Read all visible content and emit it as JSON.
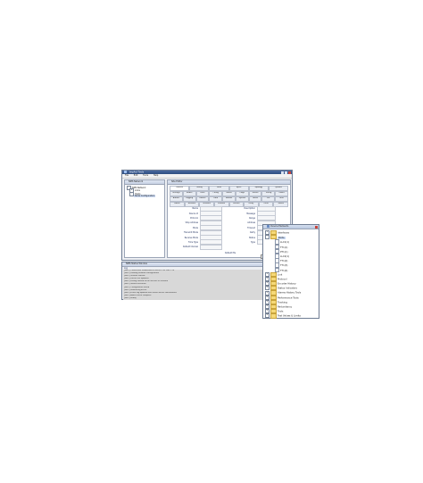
{
  "main_window": {
    "title": "ImpAct Tools",
    "menu": [
      "File",
      "Edit",
      "Tools",
      "Help"
    ],
    "tree_title": "NMS Network",
    "tree": [
      "NMS Network",
      "Links",
      "Hosts",
      "Node Configuration"
    ],
    "detail_title": "Site Editor",
    "tab_rows": [
      [
        "General",
        "Timing",
        "Links",
        "Inject",
        "Topology",
        "Options"
      ],
      [
        "Settings",
        "Modes",
        "Ports",
        "Config",
        "Status",
        "Flags",
        "Events",
        "Timing",
        "Power"
      ],
      [
        "Alarms",
        "Logging",
        "Routes",
        "Data",
        "Params",
        "System",
        "Notes",
        "Ext",
        "Misc"
      ],
      [
        "Labels",
        "Network",
        "Sessions",
        "Protocol",
        "Version",
        "Delay",
        "Other",
        "Status"
      ]
    ],
    "form_left": [
      {
        "label": "Name",
        "value": ""
      },
      {
        "label": "Device Id",
        "value": ""
      },
      {
        "label": "Protocol",
        "value": ""
      },
      {
        "label": "Stop Address",
        "value": ""
      },
      {
        "label": "Mode",
        "value": ""
      },
      {
        "label": "Transmit Mode",
        "value": ""
      },
      {
        "label": "Receive Mode",
        "value": ""
      },
      {
        "label": "Time Type",
        "value": ""
      },
      {
        "label": "Default Interval",
        "value": ""
      }
    ],
    "form_right": [
      {
        "label": "Description",
        "value": ""
      },
      {
        "label": "Message",
        "value": ""
      },
      {
        "label": "Range",
        "value": ""
      },
      {
        "label": "Address",
        "value": ""
      },
      {
        "label": "Timeout",
        "value": ""
      },
      {
        "label": "Retry",
        "value": ""
      },
      {
        "label": "Status",
        "value": ""
      },
      {
        "label": "Type",
        "value": ""
      }
    ],
    "form_footer": "Default Pts",
    "apply_label": "Apply"
  },
  "log_window": {
    "title": "NMS Status Window",
    "subtitle": "Log",
    "lines": [
      "[INFO] Connection established to server 192.168.1.10",
      "[INFO] Loading network configuration",
      "[INFO] Session started",
      "[INFO] Device list updated",
      "[INFO] Polling started for all devices in network",
      "[INFO] Status refreshed",
      "[INFO] Configuration saved",
      "[INFO] Monitoring active",
      "[INFO] Event log updated with latest device notifications",
      "[INFO] Alarm check complete",
      "[INFO] Ready"
    ]
  },
  "device_window": {
    "title": "Device Elements",
    "items": [
      {
        "level": 0,
        "expander": "+",
        "kind": "folder",
        "label": "Interfaces"
      },
      {
        "level": 0,
        "expander": "-",
        "kind": "folder",
        "label": "Ports",
        "selected": true
      },
      {
        "level": 1,
        "expander": "",
        "kind": "doc",
        "label": "LLC1(1)"
      },
      {
        "level": 1,
        "expander": "",
        "kind": "doc",
        "label": "TT1(1)"
      },
      {
        "level": 1,
        "expander": "",
        "kind": "doc",
        "label": "PT1(1)"
      },
      {
        "level": 1,
        "expander": "",
        "kind": "doc",
        "label": "LLC2(1)"
      },
      {
        "level": 1,
        "expander": "",
        "kind": "doc",
        "label": "TT1(2)"
      },
      {
        "level": 1,
        "expander": "",
        "kind": "doc",
        "label": "TT1(3)"
      },
      {
        "level": 1,
        "expander": "",
        "kind": "doc",
        "label": "TT1(4)"
      },
      {
        "level": 0,
        "expander": "+",
        "kind": "folder",
        "label": "Link"
      },
      {
        "level": 0,
        "expander": "+",
        "kind": "folder",
        "label": "Protocol"
      },
      {
        "level": 0,
        "expander": "+",
        "kind": "folder",
        "label": "Encoder History"
      },
      {
        "level": 0,
        "expander": "+",
        "kind": "folder",
        "label": "Status Indicators"
      },
      {
        "level": 0,
        "expander": "+",
        "kind": "folder",
        "label": "Alarms History Tools"
      },
      {
        "level": 0,
        "expander": "+",
        "kind": "folder",
        "label": "Performance Tools"
      },
      {
        "level": 0,
        "expander": "+",
        "kind": "folder",
        "label": "Tracking"
      },
      {
        "level": 0,
        "expander": "+",
        "kind": "folder",
        "label": "Redundancy"
      },
      {
        "level": 0,
        "expander": "+",
        "kind": "folder",
        "label": "Tools"
      },
      {
        "level": 0,
        "expander": "+",
        "kind": "folder",
        "label": "Test Values & Limits"
      }
    ]
  }
}
